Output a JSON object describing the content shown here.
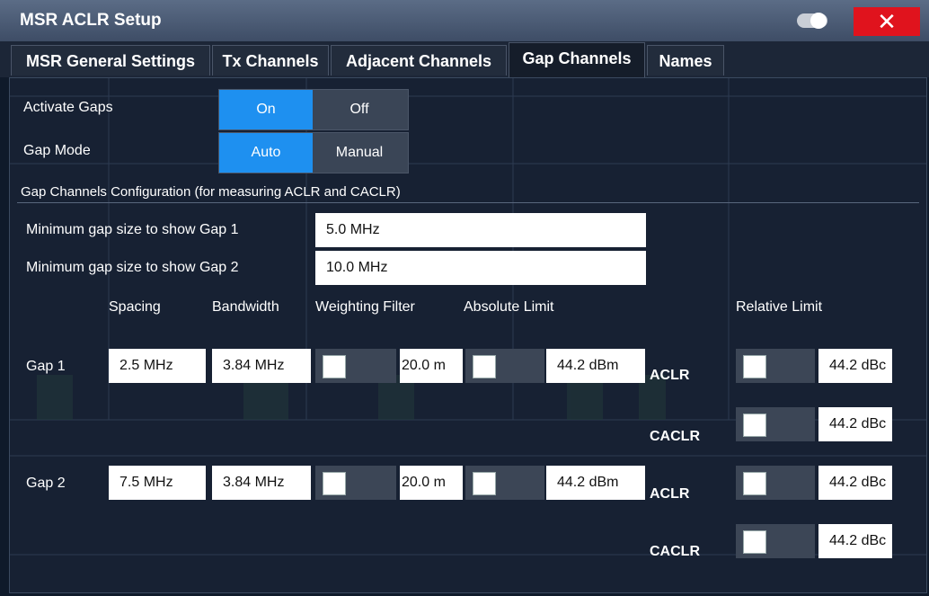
{
  "window": {
    "title": "MSR ACLR Setup",
    "close_label": "✕",
    "icons": [
      "toggle-icon",
      "close-icon"
    ]
  },
  "tabs": [
    {
      "label": "MSR General Settings",
      "active": false
    },
    {
      "label": "Tx Channels",
      "active": false
    },
    {
      "label": "Adjacent Channels",
      "active": false
    },
    {
      "label": "Gap Channels",
      "active": true
    },
    {
      "label": "Names",
      "active": false
    }
  ],
  "activate_gaps": {
    "label": "Activate Gaps",
    "options": [
      "On",
      "Off"
    ],
    "selected": "On"
  },
  "gap_mode": {
    "label": "Gap Mode",
    "options": [
      "Auto",
      "Manual"
    ],
    "selected": "Auto"
  },
  "config_section": {
    "title": "Gap Channels Configuration (for measuring ACLR and CACLR)",
    "min_gap1_label": "Minimum gap size to show Gap 1",
    "min_gap1_value": "5.0 MHz",
    "min_gap2_label": "Minimum gap size to show Gap 2",
    "min_gap2_value": "10.0 MHz"
  },
  "columns": {
    "spacing": "Spacing",
    "bandwidth": "Bandwidth",
    "weighting_filter": "Weighting Filter",
    "absolute_limit": "Absolute Limit",
    "relative_limit": "Relative Limit"
  },
  "gaps": [
    {
      "label": "Gap 1",
      "spacing": "2.5 MHz",
      "bandwidth": "3.84 MHz",
      "weighting_value": "20.0 m",
      "absolute_limit": "44.2 dBm",
      "relative": [
        {
          "type": "ACLR",
          "value": "44.2 dBc"
        },
        {
          "type": "CACLR",
          "value": "44.2 dBc"
        }
      ]
    },
    {
      "label": "Gap 2",
      "spacing": "7.5 MHz",
      "bandwidth": "3.84 MHz",
      "weighting_value": "20.0 m",
      "absolute_limit": "44.2 dBm",
      "relative": [
        {
          "type": "ACLR",
          "value": "44.2 dBc"
        },
        {
          "type": "CACLR",
          "value": "44.2 dBc"
        }
      ]
    }
  ],
  "colors": {
    "accent_blue": "#1e90f0",
    "close_red": "#e0131d",
    "panel_bg": "#182234"
  }
}
